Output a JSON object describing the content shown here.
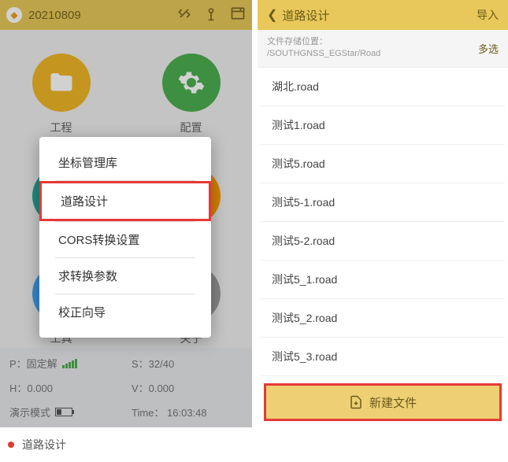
{
  "left": {
    "header": {
      "title": "20210809"
    },
    "grid": [
      {
        "label": "工程"
      },
      {
        "label": "配置"
      },
      {
        "label": ""
      },
      {
        "label": ""
      },
      {
        "label": "工具"
      },
      {
        "label": "关于"
      }
    ],
    "popup": {
      "items": [
        "坐标管理库",
        "道路设计",
        "CORS转换设置",
        "求转换参数",
        "校正向导"
      ]
    },
    "status": {
      "p_label": "P：固定解",
      "s_label": "S：32/40",
      "h_label": "H：0.000",
      "v_label": "V：0.000",
      "mode": "演示模式",
      "time": "Time： 16:03:48"
    }
  },
  "right": {
    "header": {
      "title": "道路设计",
      "import": "导入"
    },
    "path": {
      "label": "文件存储位置：",
      "value": "/SOUTHGNSS_EGStar/Road",
      "multi": "多选"
    },
    "files": [
      "湖北.road",
      "测试1.road",
      "测试5.road",
      "测试5-1.road",
      "测试5-2.road",
      "测试5_1.road",
      "测试5_2.road",
      "测试5_3.road"
    ],
    "new_btn": "新建文件"
  },
  "caption": "道路设计"
}
